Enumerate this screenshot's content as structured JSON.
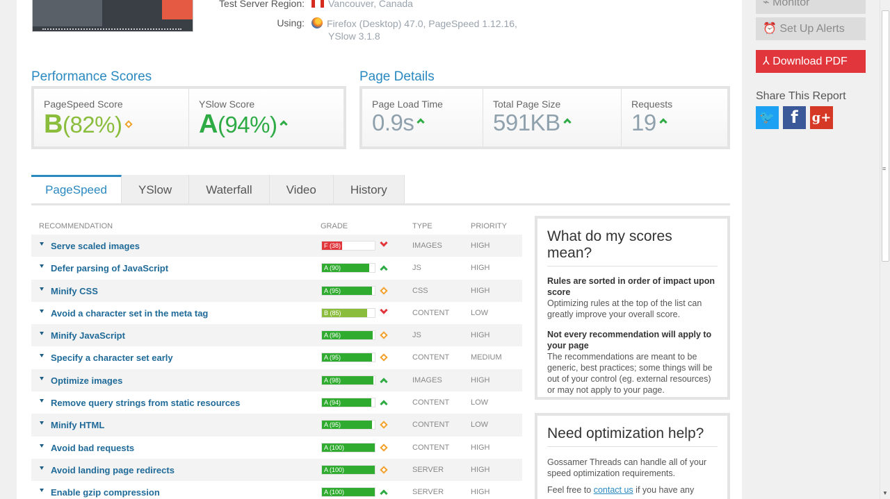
{
  "test_info": {
    "region_label": "Test Server Region:",
    "region_value": "Vancouver, Canada",
    "using_label": "Using:",
    "using_line1": "Firefox (Desktop) 47.0, PageSpeed 1.12.16,",
    "using_line2": "YSlow 3.1.8"
  },
  "performance": {
    "title": "Performance Scores",
    "pagespeed_label": "PageSpeed Score",
    "pagespeed_grade": "B",
    "pagespeed_pct": "(82%)",
    "yslow_label": "YSlow Score",
    "yslow_grade": "A",
    "yslow_pct": "(94%)"
  },
  "details": {
    "title": "Page Details",
    "load_label": "Page Load Time",
    "load_value": "0.9s",
    "size_label": "Total Page Size",
    "size_value": "591KB",
    "req_label": "Requests",
    "req_value": "19"
  },
  "tabs": [
    "PageSpeed",
    "YSlow",
    "Waterfall",
    "Video",
    "History"
  ],
  "table": {
    "headers": {
      "rec": "RECOMMENDATION",
      "grade": "GRADE",
      "type": "TYPE",
      "priority": "PRIORITY"
    },
    "rows": [
      {
        "rec": "Serve scaled images",
        "grade": "F (38)",
        "score": 38,
        "color": "#e1363c",
        "trend": "down",
        "type": "IMAGES",
        "priority": "HIGH"
      },
      {
        "rec": "Defer parsing of JavaScript",
        "grade": "A (90)",
        "score": 90,
        "color": "#2fab2f",
        "trend": "up",
        "type": "JS",
        "priority": "HIGH"
      },
      {
        "rec": "Minify CSS",
        "grade": "A (95)",
        "score": 95,
        "color": "#2fab2f",
        "trend": "same",
        "type": "CSS",
        "priority": "HIGH"
      },
      {
        "rec": "Avoid a character set in the meta tag",
        "grade": "B (85)",
        "score": 85,
        "color": "#8bbd3d",
        "trend": "down",
        "type": "CONTENT",
        "priority": "LOW"
      },
      {
        "rec": "Minify JavaScript",
        "grade": "A (96)",
        "score": 96,
        "color": "#2fab2f",
        "trend": "same",
        "type": "JS",
        "priority": "HIGH"
      },
      {
        "rec": "Specify a character set early",
        "grade": "A (95)",
        "score": 95,
        "color": "#2fab2f",
        "trend": "same",
        "type": "CONTENT",
        "priority": "MEDIUM"
      },
      {
        "rec": "Optimize images",
        "grade": "A (98)",
        "score": 98,
        "color": "#2fab2f",
        "trend": "up",
        "type": "IMAGES",
        "priority": "HIGH"
      },
      {
        "rec": "Remove query strings from static resources",
        "grade": "A (94)",
        "score": 94,
        "color": "#2fab2f",
        "trend": "up",
        "type": "CONTENT",
        "priority": "LOW"
      },
      {
        "rec": "Minify HTML",
        "grade": "A (95)",
        "score": 95,
        "color": "#2fab2f",
        "trend": "same",
        "type": "CONTENT",
        "priority": "LOW"
      },
      {
        "rec": "Avoid bad requests",
        "grade": "A (100)",
        "score": 100,
        "color": "#2fab2f",
        "trend": "same",
        "type": "CONTENT",
        "priority": "HIGH"
      },
      {
        "rec": "Avoid landing page redirects",
        "grade": "A (100)",
        "score": 100,
        "color": "#2fab2f",
        "trend": "same",
        "type": "SERVER",
        "priority": "HIGH"
      },
      {
        "rec": "Enable gzip compression",
        "grade": "A (100)",
        "score": 100,
        "color": "#2fab2f",
        "trend": "up",
        "type": "SERVER",
        "priority": "HIGH"
      }
    ]
  },
  "scores_box": {
    "title": "What do my scores mean?",
    "p1_bold": "Rules are sorted in order of impact upon score",
    "p1_text": "Optimizing rules at the top of the list can greatly improve your overall score.",
    "p2_bold": "Not every recommendation will apply to your page",
    "p2_text": "The recommendations are meant to be generic, best practices; some things will be out of your control (eg. external resources) or may not apply to your page."
  },
  "help_box": {
    "title": "Need optimization help?",
    "p1": "Gossamer Threads can handle all of your speed optimization requirements.",
    "p2_pre": "Feel free to ",
    "p2_link": "contact us",
    "p2_post": " if you have any"
  },
  "sidebar": {
    "monitor": "Monitor",
    "alerts": "Set Up Alerts",
    "pdf": "Download PDF",
    "share_title": "Share This Report"
  }
}
